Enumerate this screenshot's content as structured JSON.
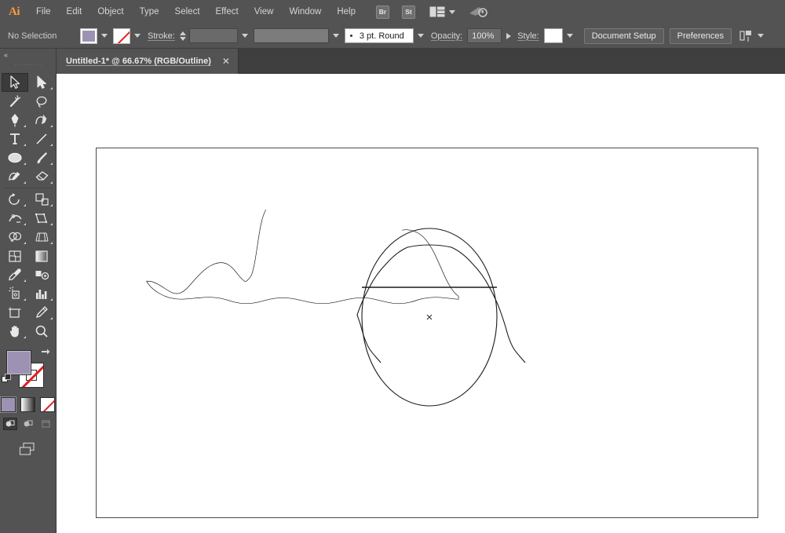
{
  "app": {
    "name": "Adobe Illustrator",
    "logo_text": "Ai"
  },
  "menubar": {
    "items": [
      {
        "label": "File"
      },
      {
        "label": "Edit"
      },
      {
        "label": "Object"
      },
      {
        "label": "Type"
      },
      {
        "label": "Select"
      },
      {
        "label": "Effect"
      },
      {
        "label": "View"
      },
      {
        "label": "Window"
      },
      {
        "label": "Help"
      }
    ],
    "bridge_badge": "Br",
    "stock_badge": "St",
    "arrange_icon": "arrange-documents-icon",
    "search_icon": "search-adobe-stock-icon"
  },
  "controlbar": {
    "selection_status": "No Selection",
    "fill_label": "fill-swatch",
    "fill_color": "#9e92b4",
    "stroke_swatch_label": "stroke-none-swatch",
    "stroke_label": "Stroke:",
    "stroke_weight_value": "",
    "stroke_profile_value": "",
    "brush_value": "3 pt. Round",
    "opacity_label": "Opacity:",
    "opacity_value": "100%",
    "style_label": "Style:",
    "style_value": "",
    "document_setup_label": "Document Setup",
    "preferences_label": "Preferences",
    "align_icon": "align-to-artboard-icon"
  },
  "tabbar": {
    "document_title": "Untitled-1* @ 66.67% (RGB/Outline)",
    "close_glyph": "✕"
  },
  "toolbar": {
    "collapse_glyph": "«",
    "tools": [
      {
        "name": "selection-tool",
        "active": true,
        "has_flyout": false
      },
      {
        "name": "direct-selection-tool",
        "active": false,
        "has_flyout": true
      },
      {
        "name": "magic-wand-tool",
        "active": false,
        "has_flyout": false
      },
      {
        "name": "lasso-tool",
        "active": false,
        "has_flyout": false
      },
      {
        "name": "pen-tool",
        "active": false,
        "has_flyout": true
      },
      {
        "name": "curvature-tool",
        "active": false,
        "has_flyout": false
      },
      {
        "name": "type-tool",
        "active": false,
        "has_flyout": true
      },
      {
        "name": "line-segment-tool",
        "active": false,
        "has_flyout": true
      },
      {
        "name": "ellipse-tool",
        "active": false,
        "has_flyout": true
      },
      {
        "name": "paintbrush-tool",
        "active": false,
        "has_flyout": true
      },
      {
        "name": "shaper-pencil-tool",
        "active": false,
        "has_flyout": true
      },
      {
        "name": "eraser-tool",
        "active": false,
        "has_flyout": true
      },
      {
        "name": "rotate-tool",
        "active": false,
        "has_flyout": true
      },
      {
        "name": "scale-tool",
        "active": false,
        "has_flyout": true
      },
      {
        "name": "width-tool",
        "active": false,
        "has_flyout": true
      },
      {
        "name": "free-transform-tool",
        "active": false,
        "has_flyout": true
      },
      {
        "name": "shape-builder-tool",
        "active": false,
        "has_flyout": true
      },
      {
        "name": "perspective-grid-tool",
        "active": false,
        "has_flyout": true
      },
      {
        "name": "mesh-tool",
        "active": false,
        "has_flyout": false
      },
      {
        "name": "gradient-tool",
        "active": false,
        "has_flyout": false
      },
      {
        "name": "eyedropper-tool",
        "active": false,
        "has_flyout": true
      },
      {
        "name": "blend-tool",
        "active": false,
        "has_flyout": false
      },
      {
        "name": "symbol-sprayer-tool",
        "active": false,
        "has_flyout": true
      },
      {
        "name": "column-graph-tool",
        "active": false,
        "has_flyout": true
      },
      {
        "name": "artboard-tool",
        "active": false,
        "has_flyout": false
      },
      {
        "name": "slice-tool",
        "active": false,
        "has_flyout": true
      },
      {
        "name": "hand-tool",
        "active": false,
        "has_flyout": true
      },
      {
        "name": "zoom-tool",
        "active": false,
        "has_flyout": false
      }
    ],
    "fill_color": "#9e92b4",
    "stroke_state": "none",
    "fill_stroke_buttons": [
      {
        "name": "color-button",
        "selected": true
      },
      {
        "name": "gradient-button",
        "selected": false
      },
      {
        "name": "none-button",
        "selected": false
      }
    ],
    "draw_modes": [
      {
        "name": "draw-normal-button",
        "active": true
      },
      {
        "name": "draw-behind-button",
        "active": false
      },
      {
        "name": "draw-inside-button",
        "active": false
      }
    ],
    "screen_mode": "change-screen-mode-button"
  },
  "canvas": {
    "view_mode": "Outline",
    "zoom_percent": "66.67%",
    "artwork_name": "veiled-figure-outline-drawing",
    "center_mark": "×"
  }
}
